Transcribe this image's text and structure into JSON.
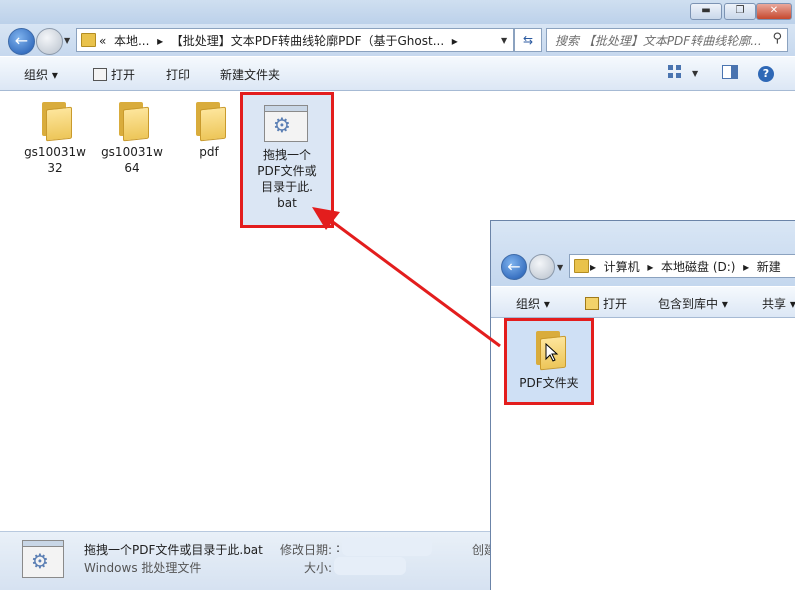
{
  "main": {
    "caption_buttons": [
      "▬",
      "❐",
      "✕"
    ],
    "address": {
      "overflow": "«",
      "segments": [
        "本地...",
        "【批处理】文本PDF转曲线轮廓PDF（基于Ghost..."
      ],
      "separator": "▸"
    },
    "search_placeholder": "搜索 【批处理】文本PDF转曲线轮廓...",
    "toolbar": {
      "organize": "组织",
      "open": "打开",
      "print": "打印",
      "new_folder": "新建文件夹"
    },
    "items": [
      {
        "name_line1": "gs10031w",
        "name_line2": "32"
      },
      {
        "name_line1": "gs10031w",
        "name_line2": "64"
      },
      {
        "name_line1": "pdf",
        "name_line2": ""
      }
    ],
    "selected_file": {
      "line1": "拖拽一个",
      "line2": "PDF文件或",
      "line3": "目录于此.",
      "line4": "bat"
    },
    "status": {
      "filename": "拖拽一个PDF文件或目录于此.bat",
      "modified_label": "修改日期:",
      "modified_value": ":",
      "type": "Windows 批处理文件",
      "size_label": "大小:",
      "created_label": "创建"
    }
  },
  "second_window": {
    "address": {
      "segments": [
        "计算机",
        "本地磁盘 (D:)",
        "新建"
      ],
      "separator": "▸"
    },
    "toolbar": {
      "organize": "组织",
      "open": "打开",
      "include_in_library": "包含到库中",
      "share": "共享"
    },
    "item": {
      "name": "PDF文件夹"
    }
  },
  "colors": {
    "highlight": "#e31d1d",
    "selection": "#dbe6f4"
  }
}
